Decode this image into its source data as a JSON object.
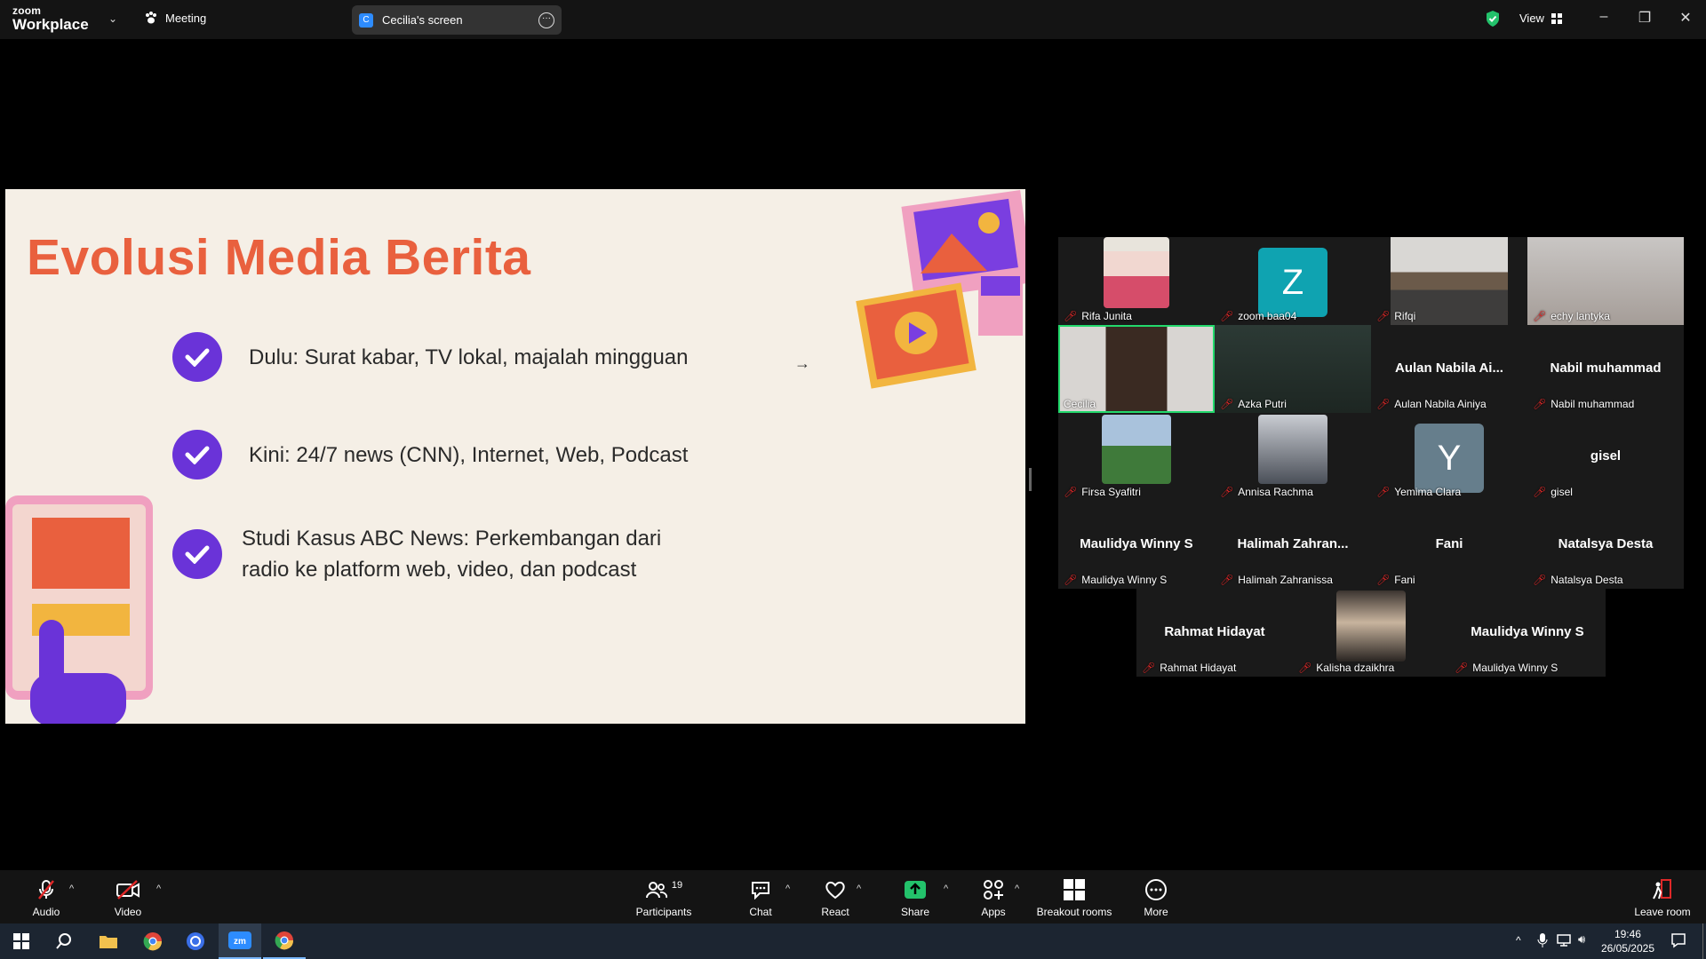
{
  "topbar": {
    "brand_top": "zoom",
    "brand_bottom": "Workplace",
    "meeting_label": "Meeting",
    "screen_badge": "C",
    "screen_title": "Cecilia's screen",
    "view_label": "View"
  },
  "slide": {
    "title": "Evolusi Media Berita",
    "bullets": [
      "Dulu: Surat kabar, TV lokal, majalah mingguan",
      "Kini: 24/7 news (CNN), Internet, Web, Podcast",
      "Studi Kasus ABC News: Perkembangan dari radio ke platform web, video, dan podcast"
    ],
    "colors": {
      "accent": "#e9603e",
      "purple": "#6a33d8",
      "pink": "#f0a0c0",
      "yellow": "#f2b53f",
      "background": "#f5efe6"
    }
  },
  "participants": [
    {
      "name": "Rifa Junita",
      "tile_text": ""
    },
    {
      "name": "zoom baa04",
      "tile_text": "",
      "letter": "Z"
    },
    {
      "name": "Rifqi",
      "tile_text": ""
    },
    {
      "name": "echy lantyka",
      "tile_text": ""
    },
    {
      "name": "Cecilia",
      "tile_text": ""
    },
    {
      "name": "Azka Putri",
      "tile_text": ""
    },
    {
      "name": "Aulan Nabila Ainiya",
      "tile_text": "Aulan  Nabila  Ai..."
    },
    {
      "name": "Nabil muhammad",
      "tile_text": "Nabil muhammad"
    },
    {
      "name": "Firsa Syafitri",
      "tile_text": ""
    },
    {
      "name": "Annisa Rachma",
      "tile_text": ""
    },
    {
      "name": "Yemima Clara",
      "tile_text": "",
      "letter": "Y"
    },
    {
      "name": "gisel",
      "tile_text": "gisel"
    },
    {
      "name": "Maulidya Winny S",
      "tile_text": "Maulidya Winny S"
    },
    {
      "name": "Halimah Zahranissa",
      "tile_text": "Halimah  Zahran..."
    },
    {
      "name": "Fani",
      "tile_text": "Fani"
    },
    {
      "name": "Natalsya Desta",
      "tile_text": "Natalsya Desta"
    },
    {
      "name": "Rahmat Hidayat",
      "tile_text": "Rahmat Hidayat"
    },
    {
      "name": "Kalisha dzaikhra",
      "tile_text": ""
    },
    {
      "name": "Maulidya Winny S",
      "tile_text": "Maulidya Winny S"
    }
  ],
  "toolbar": {
    "audio": "Audio",
    "video": "Video",
    "participants": "Participants",
    "participants_count": "19",
    "chat": "Chat",
    "react": "React",
    "share": "Share",
    "apps": "Apps",
    "breakout": "Breakout rooms",
    "more": "More",
    "leave": "Leave room"
  },
  "taskbar": {
    "time": "19:46",
    "date": "26/05/2025"
  }
}
